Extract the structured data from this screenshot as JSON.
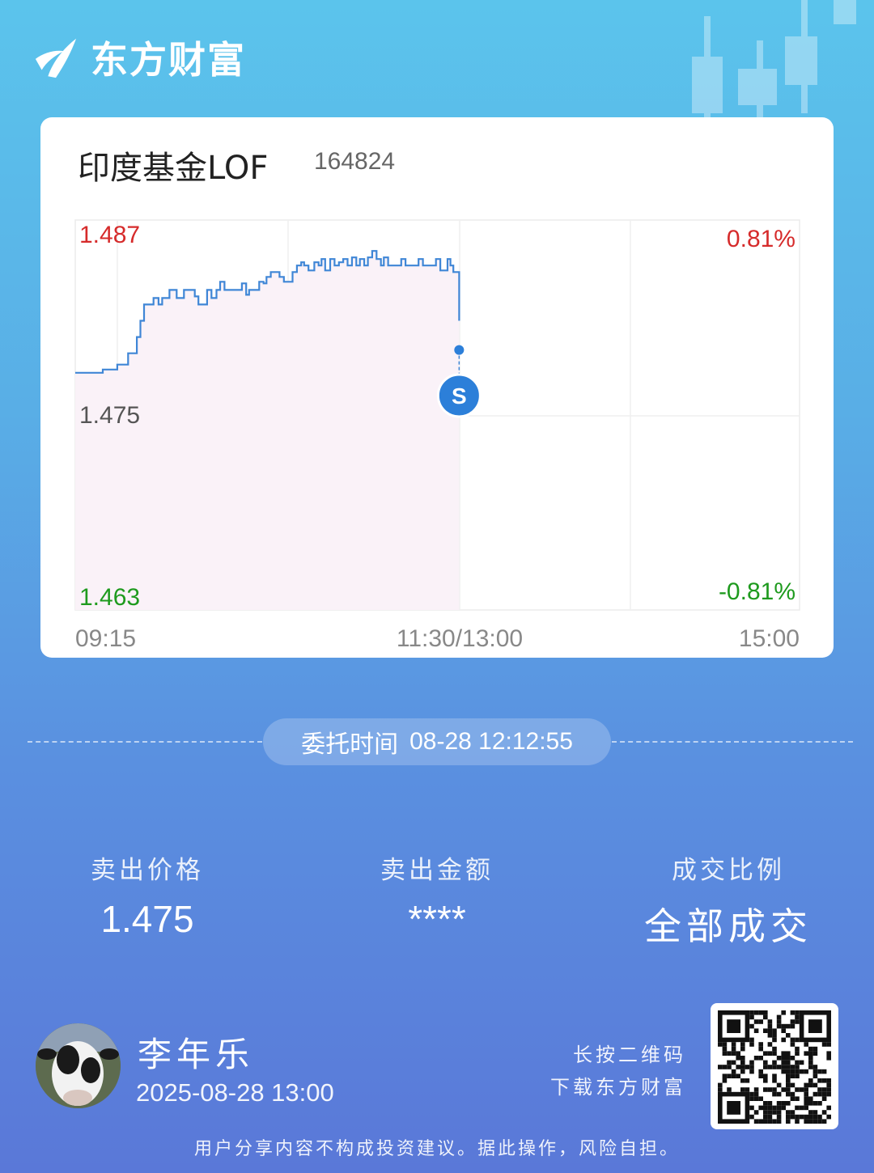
{
  "brand": {
    "name": "东方财富"
  },
  "fund": {
    "name": "印度基金LOF",
    "code": "164824"
  },
  "chart_data": {
    "type": "line",
    "y_ticks": {
      "top": "1.487",
      "mid": "1.475",
      "bottom": "1.463"
    },
    "pct_ticks": {
      "top": "0.81%",
      "bottom": "-0.81%"
    },
    "x_ticks": [
      "09:15",
      "11:30/13:00",
      "15:00"
    ],
    "ylim": [
      1.463,
      1.487
    ],
    "reference_price": 1.475,
    "marker_label": "S",
    "trade_marker": {
      "t": 0.53,
      "y": 1.479
    },
    "series": [
      {
        "x": [
          0.0,
          0.018,
          0.038,
          0.058,
          0.063,
          0.068,
          0.073,
          0.08,
          0.085,
          0.09,
          0.095,
          0.1,
          0.108,
          0.115,
          0.12,
          0.13,
          0.14,
          0.15,
          0.16,
          0.165,
          0.17,
          0.178,
          0.182,
          0.188,
          0.195,
          0.2,
          0.206,
          0.212,
          0.218,
          0.226,
          0.23,
          0.236,
          0.24,
          0.248,
          0.254,
          0.26,
          0.264,
          0.27,
          0.276,
          0.282,
          0.288,
          0.296,
          0.3,
          0.306,
          0.312,
          0.316,
          0.322,
          0.33,
          0.336,
          0.34,
          0.345,
          0.352,
          0.358,
          0.364,
          0.37,
          0.376,
          0.382,
          0.388,
          0.393,
          0.399,
          0.404,
          0.41,
          0.416,
          0.422,
          0.426,
          0.432,
          0.438,
          0.444,
          0.45,
          0.456,
          0.462,
          0.468,
          0.474,
          0.48,
          0.486,
          0.492,
          0.498,
          0.504,
          0.51,
          0.514,
          0.518,
          0.522,
          0.527,
          0.53
        ],
        "values": [
          1.4776,
          1.4776,
          1.4778,
          1.4781,
          1.4781,
          1.4781,
          1.4788,
          1.4788,
          1.4798,
          1.4808,
          1.4818,
          1.4818,
          1.4822,
          1.4818,
          1.4822,
          1.4827,
          1.4822,
          1.4827,
          1.4827,
          1.4823,
          1.4818,
          1.4818,
          1.4827,
          1.4822,
          1.4827,
          1.4832,
          1.4827,
          1.4827,
          1.4827,
          1.4827,
          1.4831,
          1.4824,
          1.4827,
          1.4827,
          1.4832,
          1.4831,
          1.4835,
          1.4838,
          1.4838,
          1.4835,
          1.4832,
          1.4832,
          1.4838,
          1.4842,
          1.4844,
          1.4842,
          1.4839,
          1.4844,
          1.4842,
          1.4846,
          1.4839,
          1.4846,
          1.4842,
          1.4844,
          1.4846,
          1.4842,
          1.4847,
          1.4842,
          1.4846,
          1.4842,
          1.4847,
          1.4851,
          1.4846,
          1.4842,
          1.4847,
          1.4842,
          1.4842,
          1.4842,
          1.4846,
          1.4842,
          1.4842,
          1.4842,
          1.4846,
          1.4842,
          1.4842,
          1.4842,
          1.4846,
          1.4839,
          1.4839,
          1.4846,
          1.4842,
          1.4838,
          1.4838,
          1.4808
        ]
      }
    ]
  },
  "order_time": {
    "label": "委托时间",
    "value": "08-28 12:12:55"
  },
  "stats": [
    {
      "label": "卖出价格",
      "value": "1.475"
    },
    {
      "label": "卖出金额",
      "value": "****"
    },
    {
      "label": "成交比例",
      "value": "全部成交"
    }
  ],
  "user": {
    "name": "李年乐",
    "datetime": "2025-08-28 13:00"
  },
  "qr_hint": {
    "line1": "长按二维码",
    "line2": "下载东方财富"
  },
  "disclaimer": "用户分享内容不构成投资建议。据此操作，风险自担。",
  "colors": {
    "up": "#d62b2b",
    "down": "#1e9a1e",
    "line": "#3f86d6",
    "marker": "#2c7fd9"
  }
}
